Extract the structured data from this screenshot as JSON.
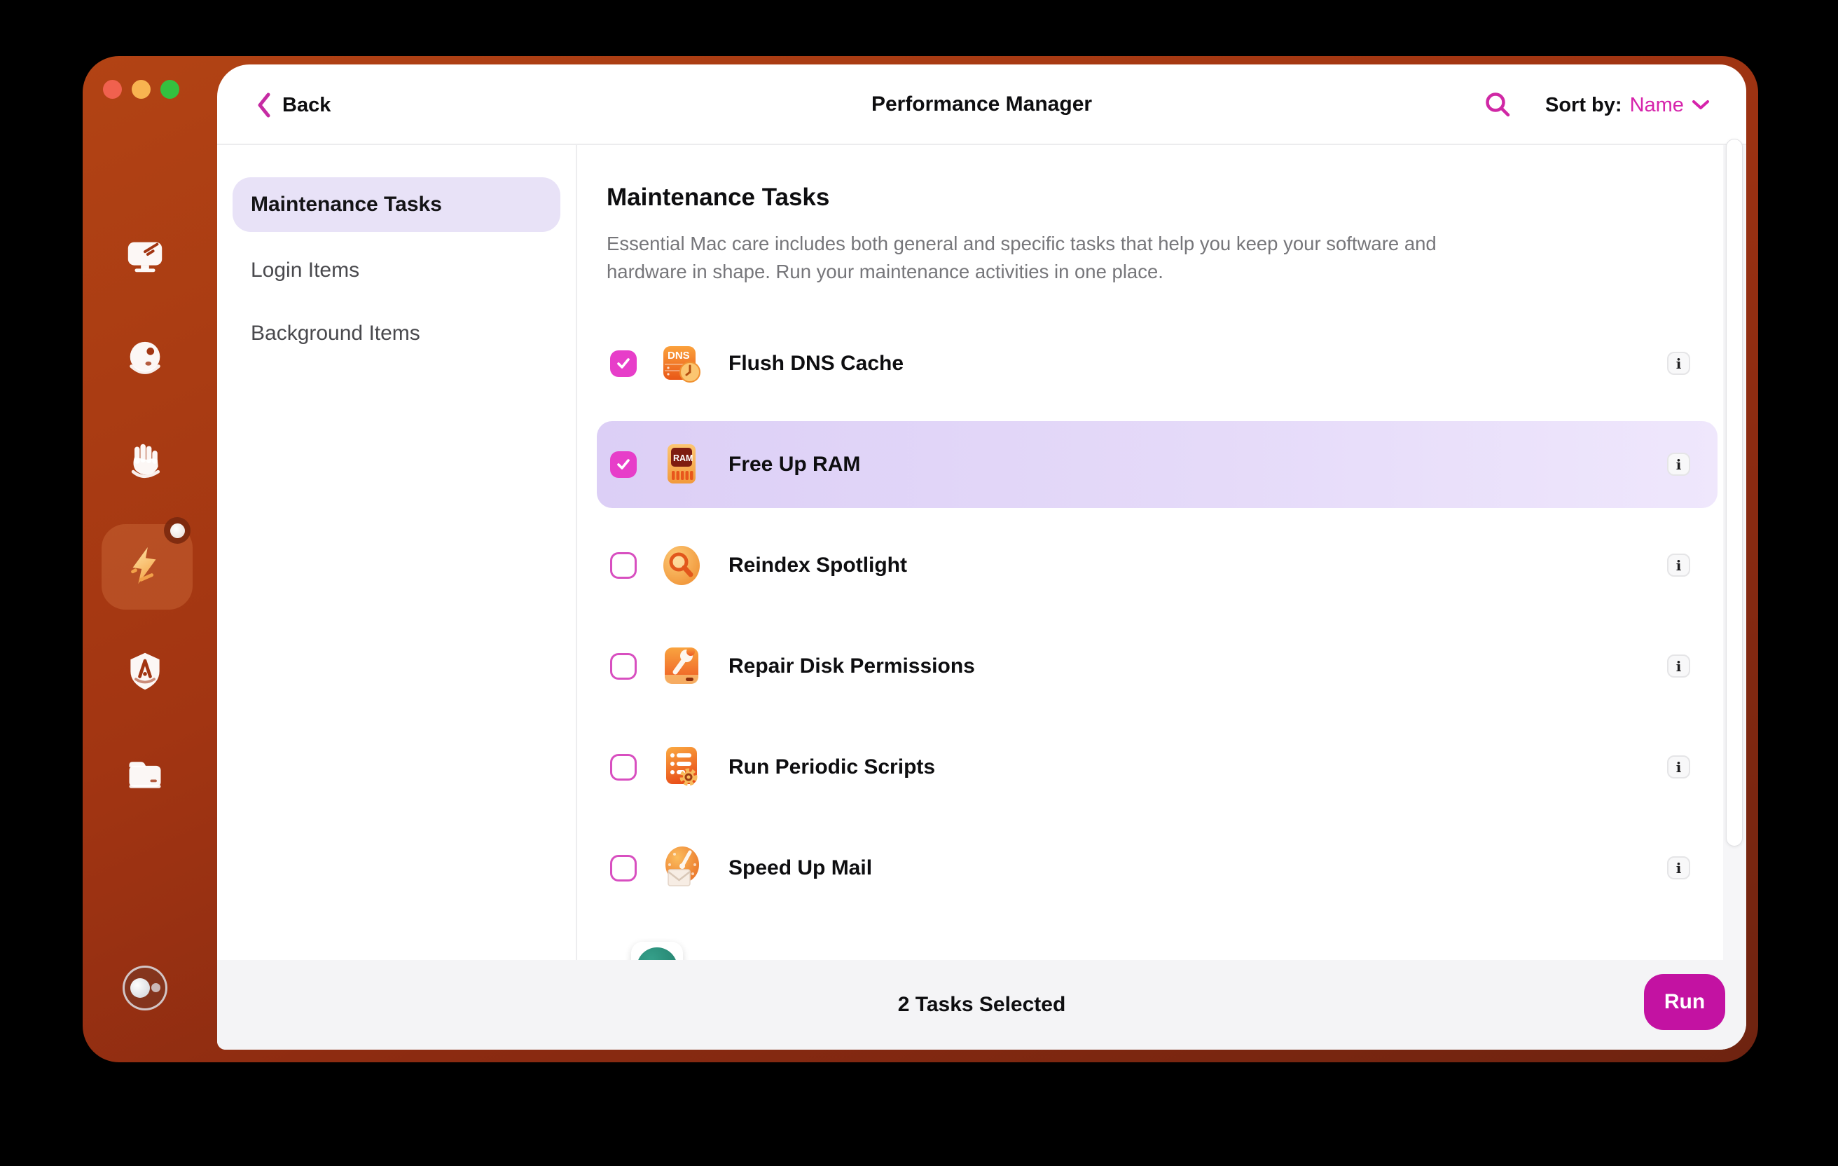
{
  "header": {
    "back": "Back",
    "title": "Performance Manager",
    "sort_label": "Sort by:",
    "sort_value": "Name"
  },
  "rail": {
    "icons": [
      "monitor-cleanup",
      "smart-scan-orb",
      "privacy-hand",
      "performance-bolt",
      "application-shield",
      "files-folder",
      "assistant-avatar"
    ],
    "active_icon": "performance-bolt",
    "has_notification_dot": true
  },
  "nav": {
    "items": [
      {
        "label": "Maintenance Tasks",
        "selected": true
      },
      {
        "label": "Login Items",
        "selected": false
      },
      {
        "label": "Background Items",
        "selected": false
      }
    ]
  },
  "content": {
    "title": "Maintenance Tasks",
    "description": "Essential Mac care includes both general and specific tasks that help you keep your software and hardware in shape. Run your maintenance activities in one place.",
    "info_label": "i",
    "tasks": [
      {
        "label": "Flush DNS Cache",
        "checked": true,
        "highlighted": false,
        "icon": "dns-clock-icon"
      },
      {
        "label": "Free Up RAM",
        "checked": true,
        "highlighted": true,
        "icon": "ram-chip-icon"
      },
      {
        "label": "Reindex Spotlight",
        "checked": false,
        "highlighted": false,
        "icon": "spotlight-magnifier-icon"
      },
      {
        "label": "Repair Disk Permissions",
        "checked": false,
        "highlighted": false,
        "icon": "disk-wrench-icon"
      },
      {
        "label": "Run Periodic Scripts",
        "checked": false,
        "highlighted": false,
        "icon": "scripts-gear-icon"
      },
      {
        "label": "Speed Up Mail",
        "checked": false,
        "highlighted": false,
        "icon": "mail-speedometer-icon"
      }
    ]
  },
  "footer": {
    "status": "2 Tasks Selected",
    "run": "Run"
  },
  "colors": {
    "accent": "#d623ab",
    "run_button": "#c312a2",
    "checkbox_checked": "#e73ec9",
    "row_highlight": "#e0d4f7",
    "nav_selected": "#e8e2f7",
    "frame_top": "#b24314",
    "frame_bottom": "#6e2310"
  }
}
